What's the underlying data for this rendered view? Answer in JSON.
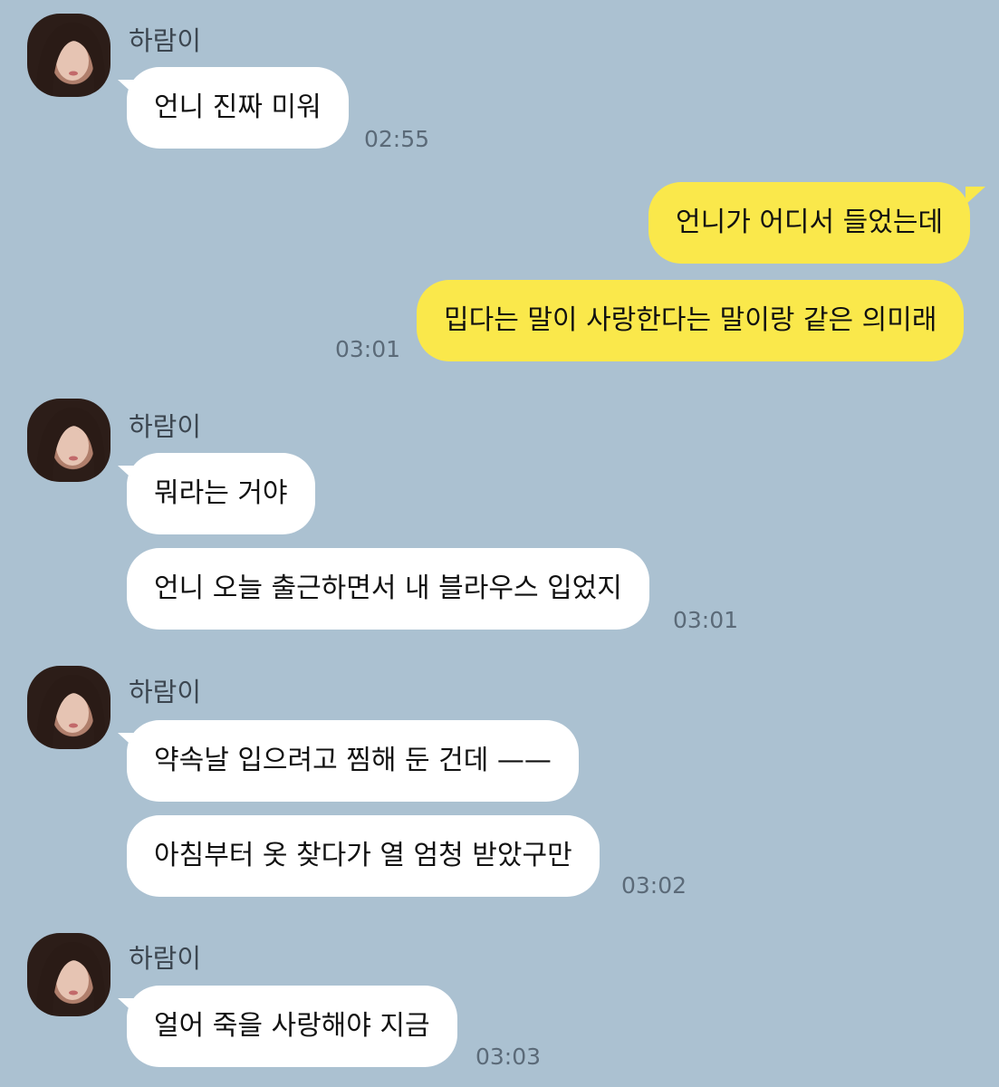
{
  "sender_name": "하람이",
  "icons": {
    "avatar": "profile-avatar-icon"
  },
  "colors": {
    "background": "#abc1d1",
    "incoming_bubble": "#ffffff",
    "outgoing_bubble": "#fae84b"
  },
  "messages": [
    {
      "from": "하람이",
      "text": "언니 진짜 미워",
      "time": "02:55"
    },
    {
      "from": "me",
      "text": "언니가 어디서 들었는데",
      "time": ""
    },
    {
      "from": "me",
      "text": "밉다는 말이 사랑한다는 말이랑 같은 의미래",
      "time": "03:01"
    },
    {
      "from": "하람이",
      "text": "뭐라는 거야",
      "time": ""
    },
    {
      "from": "하람이",
      "text": "언니 오늘 출근하면서 내 블라우스 입었지",
      "time": "03:01"
    },
    {
      "from": "하람이",
      "text": "약속날 입으려고 찜해 둔 건데 ——",
      "time": ""
    },
    {
      "from": "하람이",
      "text": "아침부터 옷 찾다가 열 엄청 받았구만",
      "time": "03:02"
    },
    {
      "from": "하람이",
      "text": "얼어 죽을 사랑해야 지금",
      "time": "03:03"
    }
  ]
}
